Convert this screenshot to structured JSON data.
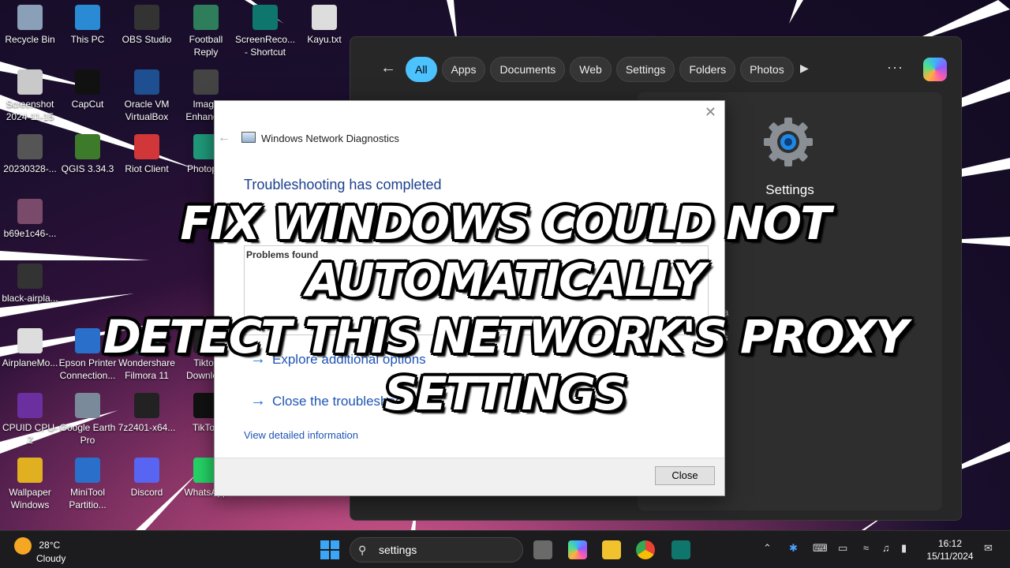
{
  "desktop_icons": [
    {
      "label": "Recycle Bin",
      "color": "#8aa0b8"
    },
    {
      "label": "This PC",
      "color": "#2a8ad4"
    },
    {
      "label": "OBS Studio",
      "color": "#333333"
    },
    {
      "label": "Football Reply",
      "color": "#2e7d5b"
    },
    {
      "label": "ScreenReco... - Shortcut",
      "color": "#0f766e"
    },
    {
      "label": "Kayu.txt",
      "color": "#dddddd"
    },
    {
      "label": "Screenshot 2024-11-15",
      "color": "#c9c9c9"
    },
    {
      "label": "CapCut",
      "color": "#111111"
    },
    {
      "label": "Oracle VM VirtualBox",
      "color": "#1d4f91"
    },
    {
      "label": "Image Enhancer",
      "color": "#444444"
    },
    {
      "label": "20230328-...",
      "color": "#555555"
    },
    {
      "label": "QGIS 3.34.3",
      "color": "#3d7a2a"
    },
    {
      "label": "Riot Client",
      "color": "#d13639"
    },
    {
      "label": "Photop...",
      "color": "#1f9a7a"
    },
    {
      "label": "b69e1c46-...",
      "color": "#7a4a6a"
    },
    {
      "label": "black-airpla...",
      "color": "#333333"
    },
    {
      "label": "AirplaneMo...",
      "color": "#dddddd"
    },
    {
      "label": "Epson Printer Connection...",
      "color": "#2a6fc9"
    },
    {
      "label": "Wondershare Filmora 11",
      "color": "#16a085"
    },
    {
      "label": "Tiktok Downlo...",
      "color": "#222222"
    },
    {
      "label": "CPUID CPU-Z",
      "color": "#6b2fa0"
    },
    {
      "label": "Google Earth Pro",
      "color": "#7a8a9a"
    },
    {
      "label": "7z2401-x64...",
      "color": "#222222"
    },
    {
      "label": "TikTok",
      "color": "#111111"
    },
    {
      "label": "Wallpaper Windows",
      "color": "#e0b020"
    },
    {
      "label": "MiniTool Partitio...",
      "color": "#2a6fc9"
    },
    {
      "label": "Discord",
      "color": "#5865f2"
    },
    {
      "label": "WhatsApp",
      "color": "#25d366"
    }
  ],
  "search_panel": {
    "tabs": [
      "All",
      "Apps",
      "Documents",
      "Web",
      "Settings",
      "Folders",
      "Photos"
    ],
    "active_tab": "All",
    "more_label": "···",
    "best_match_label": "Settings",
    "card_lines": [
      "s",
      "ba",
      "gs"
    ]
  },
  "dialog": {
    "app_title": "Windows Network Diagnostics",
    "heading": "Troubleshooting has completed",
    "problems_label": "Problems found",
    "actions": [
      "Explore additional options",
      "Close the troubleshooter"
    ],
    "detail_link": "View detailed information",
    "close_button": "Close"
  },
  "headline": {
    "line1": "FIX WINDOWS COULD NOT AUTOMATICALLY",
    "line2": "DETECT THIS NETWORK'S PROXY SETTINGS"
  },
  "taskbar": {
    "weather_temp": "28°C",
    "weather_text": "Cloudy",
    "search_value": "settings",
    "time": "16:12",
    "date": "15/11/2024"
  },
  "colors": {
    "accent": "#4cc2ff",
    "dialog_heading": "#1d3f8f",
    "link": "#1f55b5"
  }
}
